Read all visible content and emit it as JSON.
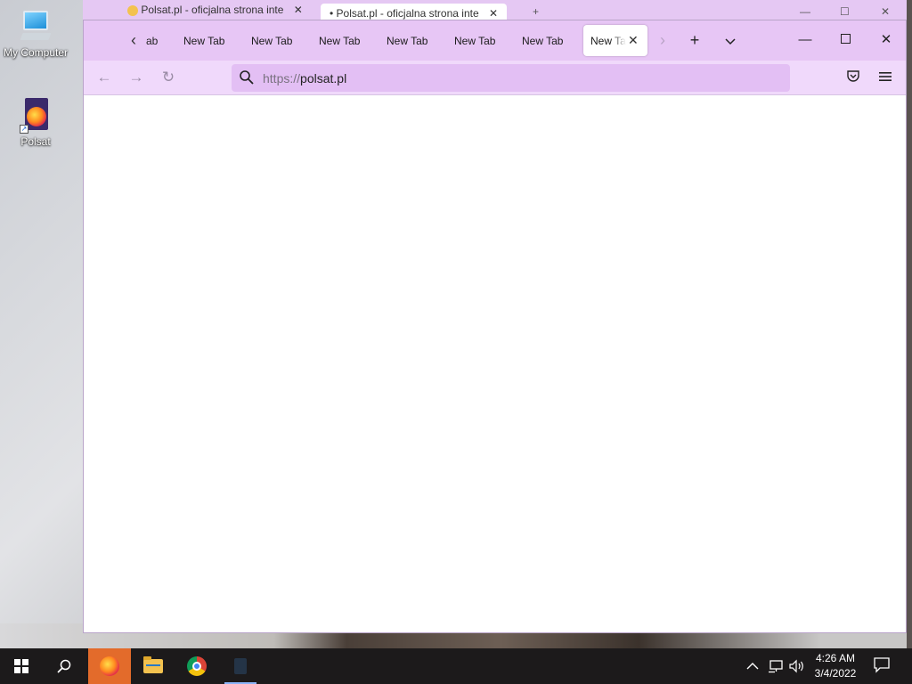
{
  "desktop": {
    "icons": [
      {
        "label": "My Computer",
        "icon": "computer-icon"
      },
      {
        "label": "Polsat",
        "icon": "firefox-shortcut-icon"
      }
    ]
  },
  "background_window": {
    "tabs": [
      {
        "label": "Polsat.pl - oficjalna strona inte"
      },
      {
        "label": "Polsat.pl - oficjalna strona inte"
      }
    ]
  },
  "browser": {
    "tab_partial": "ab",
    "tabs": [
      {
        "label": "New Tab"
      },
      {
        "label": "New Tab"
      },
      {
        "label": "New Tab"
      },
      {
        "label": "New Tab"
      },
      {
        "label": "New Tab"
      },
      {
        "label": "New Tab"
      }
    ],
    "active_tab": {
      "label": "New Tab"
    },
    "url": {
      "scheme": "https://",
      "host": "polsat.pl"
    },
    "theme_colors": {
      "tabbar": "#e7c6f5",
      "navbar": "#f0d9fb",
      "urlbar": "#e3bff4"
    }
  },
  "taskbar": {
    "apps": [
      {
        "name": "firefox",
        "active": true
      },
      {
        "name": "file-explorer"
      },
      {
        "name": "chrome"
      },
      {
        "name": "app"
      }
    ],
    "clock": {
      "time": "4:26 AM",
      "date": "3/4/2022"
    }
  }
}
